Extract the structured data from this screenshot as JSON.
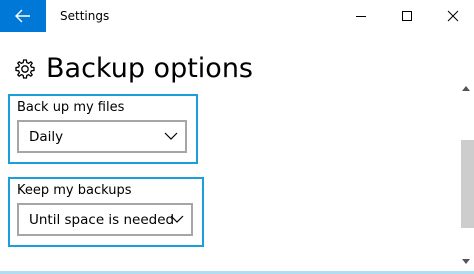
{
  "titlebar": {
    "title": "Settings",
    "back_icon": "back-arrow-icon",
    "accent": "#0078d7"
  },
  "header": {
    "icon": "gear-icon",
    "title": "Backup options"
  },
  "backup_frequency": {
    "label": "Back up my files",
    "value": "Daily"
  },
  "keep_backups": {
    "label": "Keep my backups",
    "value": "Until space is needed"
  },
  "highlight_color": "#1a9fdb"
}
